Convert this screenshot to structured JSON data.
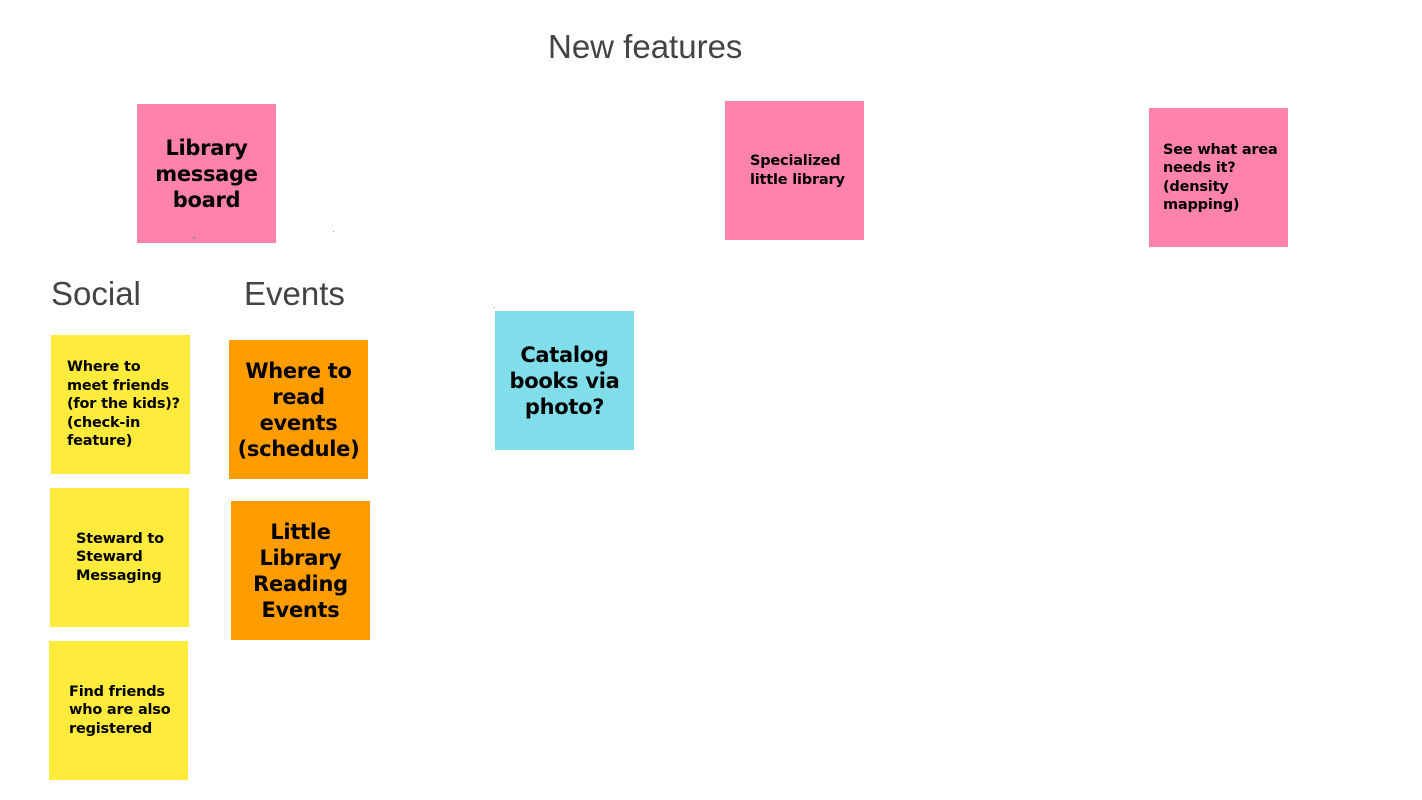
{
  "board": {
    "title": "New features",
    "columns": {
      "social": "Social",
      "events": "Events"
    }
  },
  "notes": {
    "library_message_board": "Library message board",
    "specialized_little_library": "Specialized little library",
    "density_mapping": "See what area needs it? (density mapping)",
    "catalog_books": "Catalog books via photo?",
    "meet_friends": "Where to meet friends (for the kids)? (check-in feature)",
    "steward_messaging": "Steward to Steward Messaging",
    "find_friends": "Find friends who are also registered",
    "read_events": "Where to read events (schedule)",
    "reading_events": "Little Library Reading Events"
  },
  "colors": {
    "pink": "#ff82ac",
    "yellow": "#ffeb3b",
    "orange": "#ff9d00",
    "cyan": "#80deea",
    "heading": "#434343"
  }
}
